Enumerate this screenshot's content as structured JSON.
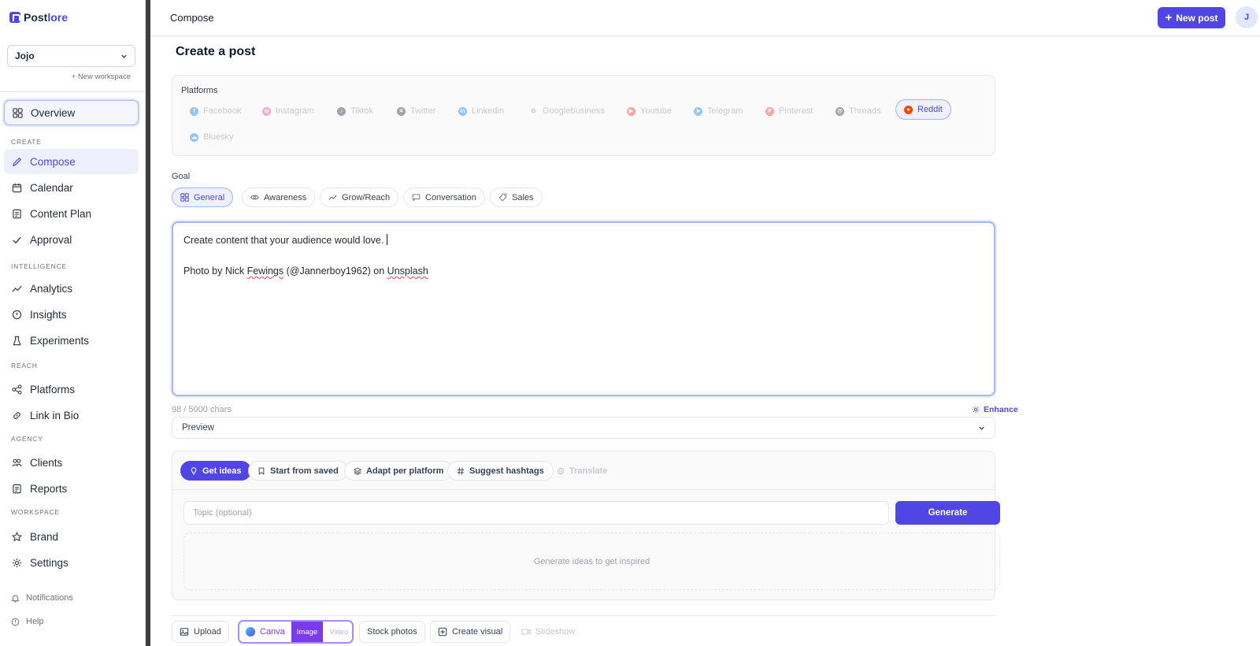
{
  "app": {
    "brand_a": "Post",
    "brand_b": "lore"
  },
  "workspace": {
    "selected": "Jojo",
    "new_label": "+ New workspace"
  },
  "nav": {
    "overview": "Overview",
    "sections": {
      "create": "CREATE",
      "intelligence": "INTELLIGENCE",
      "reach": "REACH",
      "agency": "AGENCY",
      "workspace": "WORKSPACE"
    },
    "compose": "Compose",
    "calendar": "Calendar",
    "content_plan": "Content Plan",
    "approval": "Approval",
    "analytics": "Analytics",
    "insights": "Insights",
    "experiments": "Experiments",
    "platforms": "Platforms",
    "link_in_bio": "Link in Bio",
    "clients": "Clients",
    "reports": "Reports",
    "brand": "Brand",
    "settings": "Settings",
    "notifications": "Notifications",
    "help": "Help"
  },
  "topbar": {
    "title": "Compose",
    "new_post": "New post",
    "avatar": "J"
  },
  "page": {
    "title": "Create a post"
  },
  "platforms": {
    "label": "Platforms",
    "items": [
      "Facebook",
      "Instagram",
      "Tiktok",
      "Twitter",
      "Linkedin",
      "Googlebusiness",
      "Youtube",
      "Telegram",
      "Pinterest",
      "Threads",
      "Reddit",
      "Bluesky"
    ],
    "selected": "Reddit"
  },
  "goal": {
    "label": "Goal",
    "items": [
      "General",
      "Awareness",
      "Grow/Reach",
      "Conversation",
      "Sales"
    ],
    "selected": "General"
  },
  "editor": {
    "line1": "Create content that your audience would love.",
    "line2_a": "Photo by Nick ",
    "line2_b": "Fewings",
    "line2_c": " (@Jannerboy1962) on ",
    "line2_d": "Unsplash"
  },
  "counter": {
    "chars": "98 / 5000 chars",
    "enhance": "Enhance"
  },
  "preview": {
    "label": "Preview"
  },
  "ai": {
    "get_ideas": "Get ideas",
    "start_from_saved": "Start from saved",
    "adapt": "Adapt per platform",
    "hashtags": "Suggest hashtags",
    "translate": "Translate",
    "topic_placeholder": "Topic (optional)",
    "generate": "Generate",
    "empty": "Generate ideas to get inspired"
  },
  "media": {
    "upload": "Upload",
    "canva": "Canva",
    "image": "Image",
    "video": "Video",
    "stock": "Stock photos",
    "create_visual": "Create visual",
    "slideshow": "Slideshow"
  },
  "colors": {
    "accent": "#4f46e5",
    "selected_bg": "#eef0fd",
    "reddit": "#ff4500"
  }
}
